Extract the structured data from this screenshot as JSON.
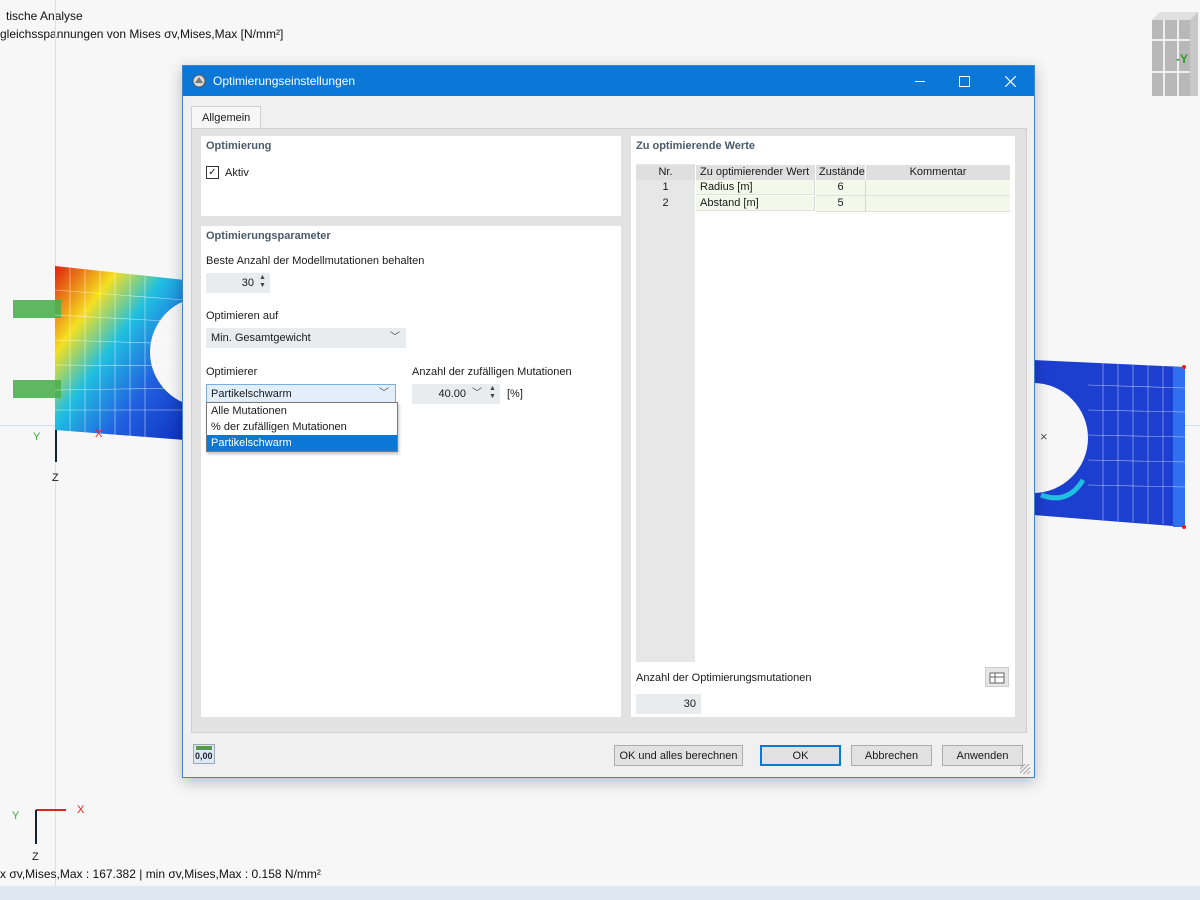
{
  "viewport": {
    "title_line1": "tische Analyse",
    "title_line2": "gleichsspannungen von Mises σv,Mises,Max [N/mm²]",
    "bottom_status": "x σv,Mises,Max : 167.382 | min σv,Mises,Max : 0.158 N/mm²",
    "axis_z_top": "Z",
    "axis_y_top": "Y",
    "axis_x_top": "X",
    "axis_x_bottom": "X",
    "axis_y_bottom": "Y",
    "axis_z_bottom": "Z",
    "view_cube_label": "-Y",
    "colors": {
      "accent": "#0b78d7",
      "mesh_blue": "#1d3fd0",
      "stress_red": "#e02010"
    }
  },
  "dialog": {
    "title": "Optimierungseinstellungen",
    "tabs": [
      "Allgemein"
    ],
    "optimization_section": {
      "title": "Optimierung",
      "active_label": "Aktiv",
      "active_checked": "✓"
    },
    "parameters_section": {
      "title": "Optimierungsparameter",
      "keep_best_label": "Beste Anzahl der Modellmutationen behalten",
      "keep_best_value": "30",
      "optimize_on_label": "Optimieren auf",
      "optimize_on_value": "Min. Gesamtgewicht",
      "optimizer_label": "Optimierer",
      "optimizer_value": "Partikelschwarm",
      "optimizer_options": [
        "Alle Mutationen",
        "% der zufälligen Mutationen",
        "Partikelschwarm"
      ],
      "random_mutations_label": "Anzahl der zufälligen Mutationen",
      "random_mutations_value": "40.00",
      "random_mutations_unit": "[%]"
    },
    "values_section": {
      "title": "Zu optimierende Werte",
      "columns": [
        "Nr.",
        "Zu optimierender Wert",
        "Zustände",
        "Kommentar"
      ],
      "rows": [
        {
          "nr": "1",
          "value": "Radius [m]",
          "states": "6",
          "comment": ""
        },
        {
          "nr": "2",
          "value": "Abstand [m]",
          "states": "5",
          "comment": ""
        }
      ],
      "mutations_label": "Anzahl der Optimierungsmutationen",
      "mutations_value": "30"
    },
    "footer": {
      "units_icon_text": "0,00",
      "buttons": {
        "ok_calc": "OK und alles berechnen",
        "ok": "OK",
        "cancel": "Abbrechen",
        "apply": "Anwenden"
      }
    }
  }
}
